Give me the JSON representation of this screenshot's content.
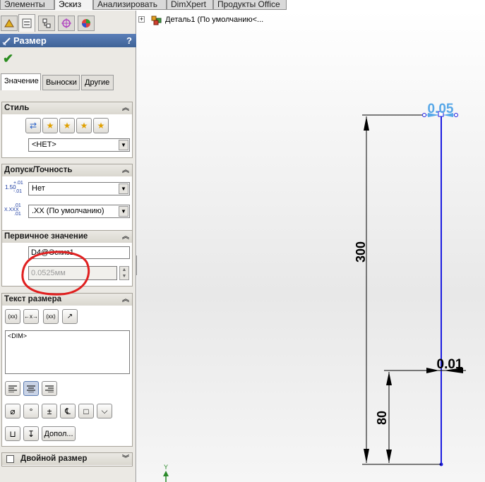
{
  "command_tabs": [
    "Элементы",
    "Эскиз",
    "Анализировать",
    "DimXpert",
    "Продукты Office"
  ],
  "active_command_tab": "Эскиз",
  "property_manager": {
    "title": "Размер",
    "help": "?",
    "tabs": [
      "Значение",
      "Выноски",
      "Другие"
    ],
    "style_group": {
      "title": "Стиль",
      "selected": "<НЕТ>"
    },
    "tolerance_group": {
      "title": "Допуск/Точность",
      "tolerance_type": "Нет",
      "precision": ".XX (По умолчанию)",
      "tol_icon_top": "1.50",
      "tol_icon_sup": "+.01",
      "tol_icon_sub": "-.01",
      "prec_icon_top": "X.XXX",
      "prec_icon_sup": ".01",
      "prec_icon_sub": ".01"
    },
    "primary_value_group": {
      "title": "Первичное значение",
      "name": "D4@Эскиз1",
      "value": "0.0525мм"
    },
    "dimension_text_group": {
      "title": "Текст размера",
      "text": "<DIM>",
      "more_button": "Допол..."
    },
    "dual_dimension": {
      "label": "Двойной размер"
    }
  },
  "feature_tree": {
    "item": "Деталь1  (По умолчанию<..."
  },
  "graphics": {
    "dim_vertical_long": "300",
    "dim_vertical_short": "80",
    "dim_top": "0.05",
    "dim_right": "0.01",
    "axis_label": "Y",
    "colors": {
      "line": "#1c1ce0",
      "dim_highlight": "#58a8e8",
      "annotation": "#e02020"
    }
  }
}
